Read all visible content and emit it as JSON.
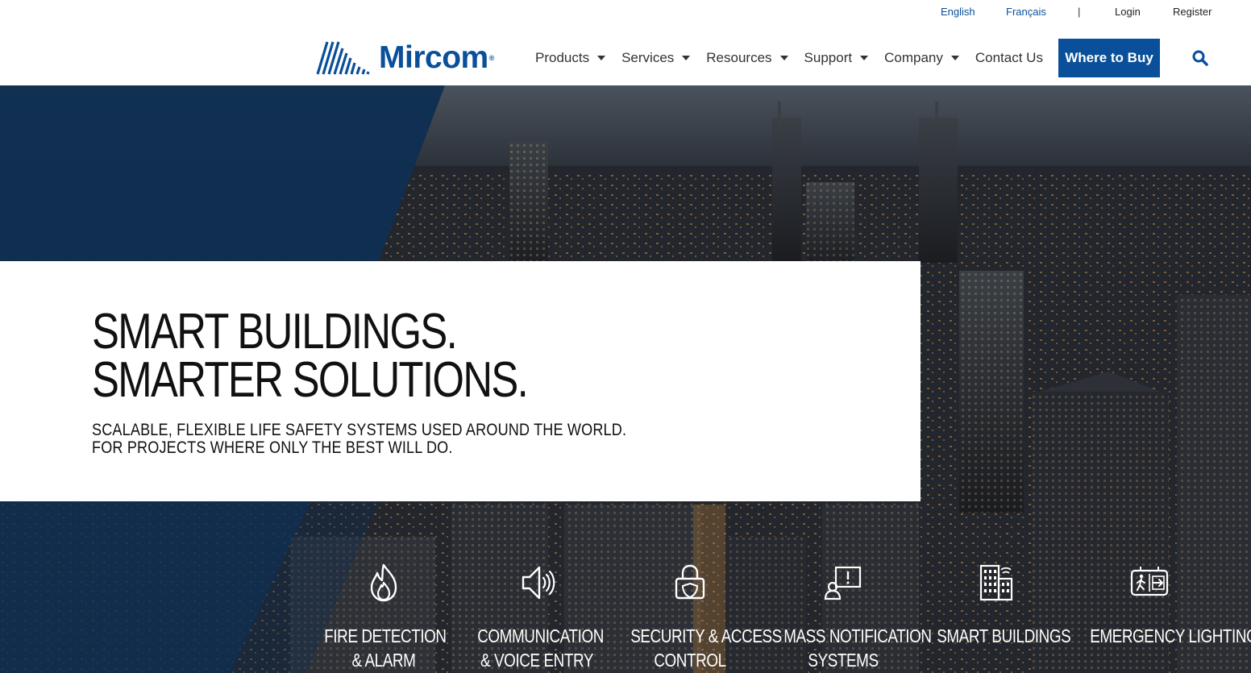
{
  "utility": {
    "english": "English",
    "francais": "Français",
    "separator": "|",
    "login": "Login",
    "register": "Register"
  },
  "header": {
    "logo_text": "Mircom",
    "logo_reg": "®",
    "nav": [
      {
        "label": "Products",
        "has_dropdown": true
      },
      {
        "label": "Services",
        "has_dropdown": true
      },
      {
        "label": "Resources",
        "has_dropdown": true
      },
      {
        "label": "Support",
        "has_dropdown": true
      },
      {
        "label": "Company",
        "has_dropdown": true
      },
      {
        "label": "Contact Us",
        "has_dropdown": false
      }
    ],
    "cta": "Where to Buy",
    "search_icon": "search-icon"
  },
  "hero": {
    "title_line1": "SMART BUILDINGS.",
    "title_line2": "SMARTER SOLUTIONS.",
    "sub_line1": "SCALABLE, FLEXIBLE LIFE SAFETY SYSTEMS USED AROUND THE WORLD.",
    "sub_line2": "FOR PROJECTS WHERE ONLY THE BEST WILL DO."
  },
  "categories": [
    {
      "icon": "flame-icon",
      "line1": "FIRE DETECTION",
      "line2": "& ALARM"
    },
    {
      "icon": "speaker-icon",
      "line1": "COMMUNICATION",
      "line2": "& VOICE ENTRY"
    },
    {
      "icon": "lock-shield-icon",
      "line1": "SECURITY & ACCESS",
      "line2": "CONTROL"
    },
    {
      "icon": "alert-message-icon",
      "line1": "MASS NOTIFICATION",
      "line2": "SYSTEMS"
    },
    {
      "icon": "building-wifi-icon",
      "line1": "SMART BUILDINGS",
      "line2": ""
    },
    {
      "icon": "exit-sign-icon",
      "line1": "EMERGENCY LIGHTING",
      "line2": ""
    }
  ],
  "colors": {
    "brand_blue": "#0a4f9a",
    "panel_navy": "#0f2f52",
    "text_dark": "#111111"
  }
}
